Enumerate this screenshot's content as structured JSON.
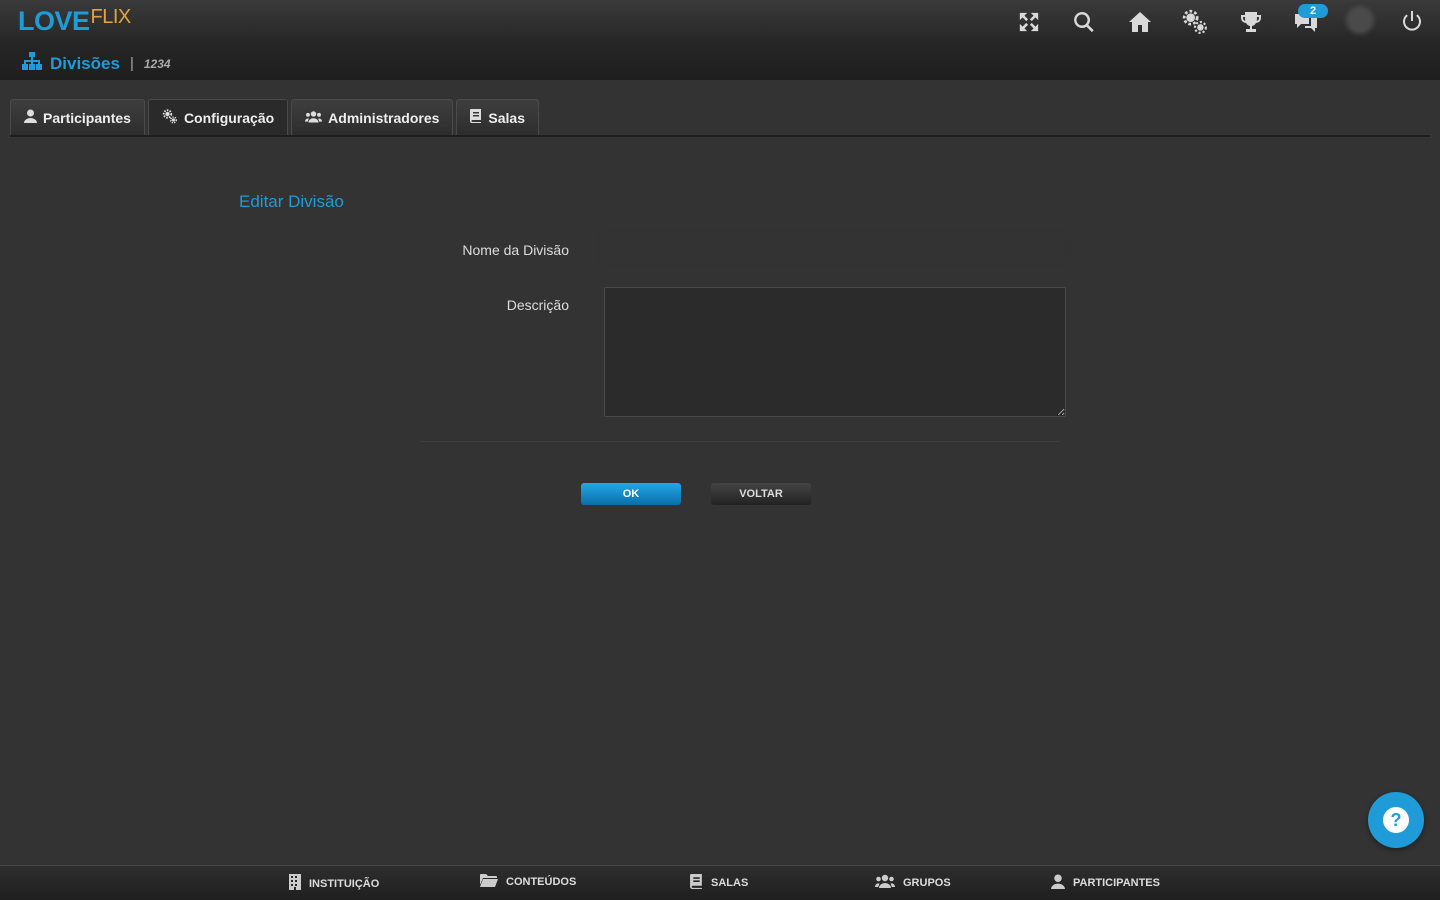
{
  "brand": {
    "love": "LOVE",
    "flix": "FLIX"
  },
  "topbar": {
    "icons": [
      "fullscreen-icon",
      "search-icon",
      "home-icon",
      "settings-icon",
      "trophy-icon",
      "chat-icon",
      "avatar",
      "power-icon"
    ],
    "notification_count": "2"
  },
  "breadcrumb": {
    "title": "Divisões",
    "separator": "|",
    "code": "1234"
  },
  "tabs": [
    {
      "label": "Participantes",
      "icon": "user-icon"
    },
    {
      "label": "Configuração",
      "icon": "cogs-icon",
      "active": true
    },
    {
      "label": "Administradores",
      "icon": "users-icon"
    },
    {
      "label": "Salas",
      "icon": "book-icon"
    }
  ],
  "form": {
    "title": "Editar Divisão",
    "name_label": "Nome da Divisão",
    "name_value": "",
    "description_label": "Descrição",
    "description_value": "",
    "ok_label": "OK",
    "back_label": "VOLTAR"
  },
  "help": {
    "label": "?"
  },
  "bottom_nav": [
    {
      "label": "INSTITUIÇÃO",
      "icon": "building-icon"
    },
    {
      "label": "CONTEÚDOS",
      "icon": "folder-icon"
    },
    {
      "label": "SALAS",
      "icon": "book-icon"
    },
    {
      "label": "GRUPOS",
      "icon": "users-icon"
    },
    {
      "label": "PARTICIPANTES",
      "icon": "user-icon"
    }
  ],
  "colors": {
    "accent": "#1f9bd7",
    "logo_secondary": "#e8a23b",
    "background": "#333333"
  }
}
